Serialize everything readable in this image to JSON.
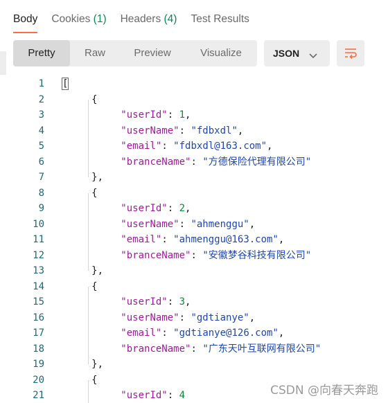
{
  "tabs": {
    "body": "Body",
    "cookies": "Cookies",
    "cookies_count": "(1)",
    "headers": "Headers",
    "headers_count": "(4)",
    "test_results": "Test Results"
  },
  "view_modes": [
    "Pretty",
    "Raw",
    "Preview",
    "Visualize"
  ],
  "active_view_mode": "Pretty",
  "format_select": {
    "value": "JSON"
  },
  "icons": {
    "wrap": "wrap-lines-icon",
    "chevron": "chevron-down-icon"
  },
  "colors": {
    "accent": "#ff6c37",
    "key": "#a21a9e",
    "string": "#1f47b3",
    "number": "#0a8a37",
    "count": "#0c8a4d"
  },
  "response": [
    {
      "userId": 1,
      "userName": "fdbxdl",
      "email": "fdbxdl@163.com",
      "branceName": "方德保险代理有限公司"
    },
    {
      "userId": 2,
      "userName": "ahmenggu",
      "email": "ahmenggu@163.com",
      "branceName": "安徽梦谷科技有限公司"
    },
    {
      "userId": 3,
      "userName": "gdtianye",
      "email": "gdtianye@126.com",
      "branceName": "广东天叶互联网有限公司"
    },
    {
      "userId": 4
    }
  ],
  "line_numbers": [
    "1",
    "2",
    "3",
    "4",
    "5",
    "6",
    "7",
    "8",
    "9",
    "10",
    "11",
    "12",
    "13",
    "14",
    "15",
    "16",
    "17",
    "18",
    "19",
    "20",
    "21"
  ],
  "watermark": "CSDN @向春天奔跑"
}
